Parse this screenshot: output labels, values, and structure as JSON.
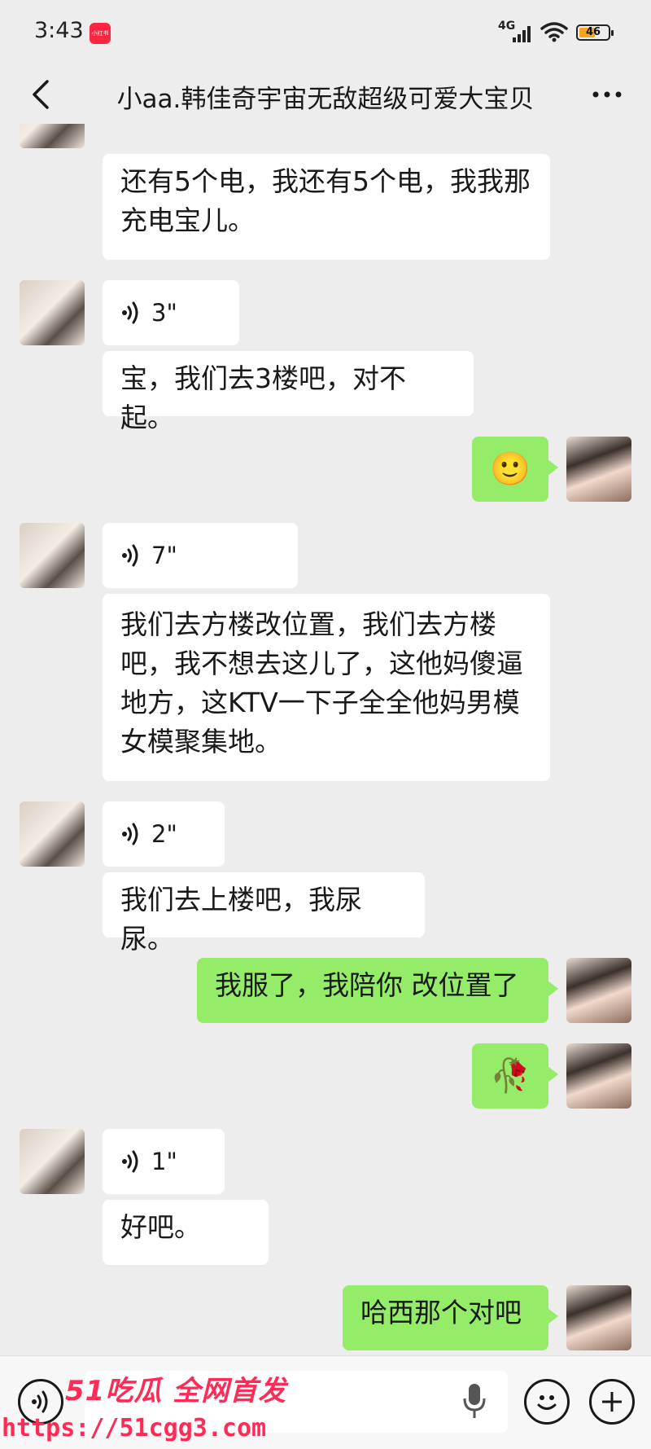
{
  "status": {
    "time": "3:43",
    "app_badge": "小红书",
    "network": "4G",
    "battery": "46"
  },
  "header": {
    "title": "小aa.韩佳奇宇宙无敌超级可爱大宝贝"
  },
  "messages": [
    {
      "side": "left",
      "type": "text",
      "text": "还有5个电，我还有5个电，我我那充电宝儿。"
    },
    {
      "side": "left",
      "type": "voice",
      "duration": "3\""
    },
    {
      "side": "left",
      "type": "text",
      "text": "宝，我们去3楼吧，对不起。"
    },
    {
      "side": "right",
      "type": "emoji",
      "emoji": "🙂",
      "icon": "smile-emoji-icon"
    },
    {
      "side": "left",
      "type": "voice",
      "duration": "7\""
    },
    {
      "side": "left",
      "type": "text",
      "text": "我们去方楼改位置，我们去方楼吧，我不想去这儿了，这他妈傻逼地方，这KTV一下子全全他妈男模女模聚集地。"
    },
    {
      "side": "left",
      "type": "voice",
      "duration": "2\""
    },
    {
      "side": "left",
      "type": "text",
      "text": "我们去上楼吧，我尿尿。"
    },
    {
      "side": "right",
      "type": "text",
      "text": "我服了，我陪你 改位置了"
    },
    {
      "side": "right",
      "type": "emoji",
      "emoji": "🥀",
      "icon": "wilted-rose-icon"
    },
    {
      "side": "left",
      "type": "voice",
      "duration": "1\""
    },
    {
      "side": "left",
      "type": "text",
      "text": "好吧。"
    },
    {
      "side": "right",
      "type": "text",
      "text": "哈西那个对吧"
    }
  ],
  "watermark": {
    "line1": "51吃瓜 全网首发",
    "line2": "https://51cgg3.com"
  },
  "colors": {
    "background": "#ededed",
    "bubble_self": "#95ec69",
    "bubble_other": "#ffffff",
    "watermark": "#ff2a55"
  }
}
